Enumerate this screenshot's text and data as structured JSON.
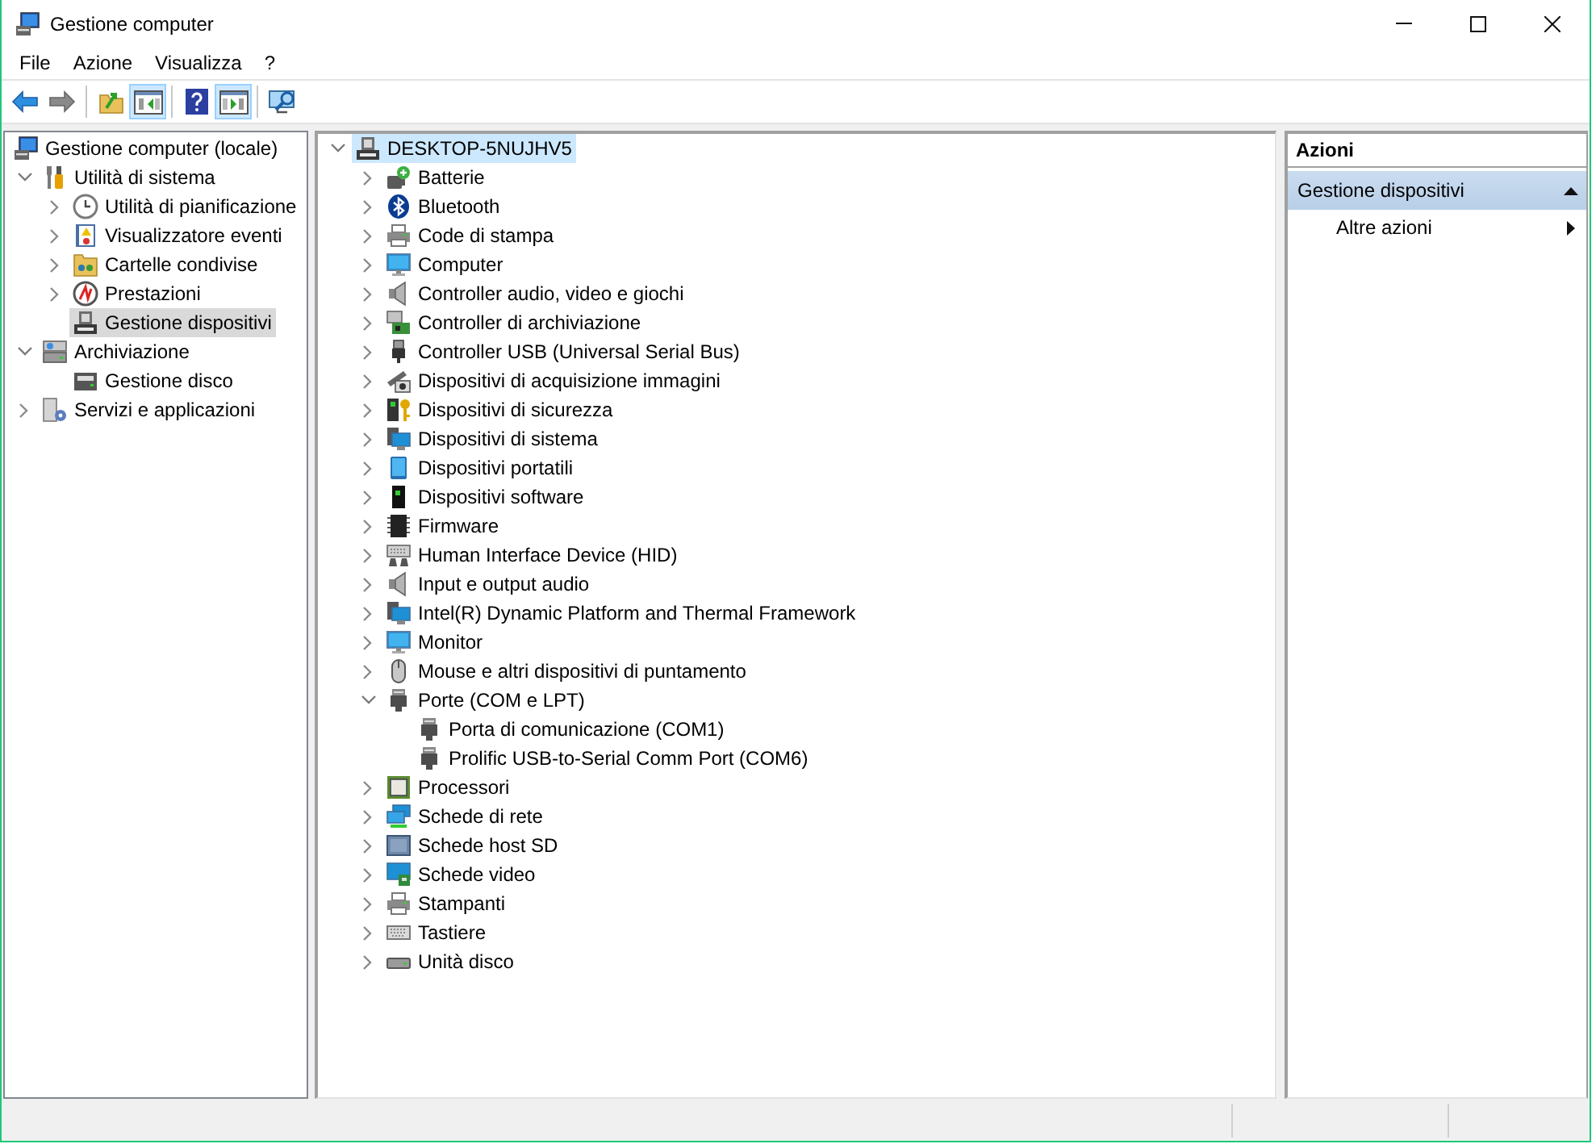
{
  "window": {
    "title": "Gestione computer"
  },
  "menu": [
    "File",
    "Azione",
    "Visualizza",
    "?"
  ],
  "toolbar": {
    "groups": [
      {
        "buttons": [
          {
            "kind": "back",
            "pressed": false,
            "disabled": false
          },
          {
            "kind": "forward",
            "pressed": false,
            "disabled": true
          }
        ]
      },
      {
        "buttons": [
          {
            "kind": "up",
            "pressed": false,
            "disabled": false
          },
          {
            "kind": "tree",
            "pressed": true,
            "disabled": false
          }
        ]
      },
      {
        "buttons": [
          {
            "kind": "help",
            "pressed": false,
            "disabled": false
          },
          {
            "kind": "actionpane",
            "pressed": true,
            "disabled": false
          }
        ]
      },
      {
        "buttons": [
          {
            "kind": "monitor",
            "pressed": false,
            "disabled": false
          }
        ]
      }
    ]
  },
  "console_tree": {
    "root": {
      "label": "Gestione computer (locale)",
      "kind": "management",
      "selected": false,
      "children": [
        {
          "label": "Utilità di sistema",
          "kind": "tools",
          "selected": false,
          "expanded": true,
          "children": [
            {
              "label": "Utilità di pianificazione",
              "kind": "clock",
              "selected": false,
              "expanded": false
            },
            {
              "label": "Visualizzatore eventi",
              "kind": "eventlog",
              "selected": false,
              "expanded": false
            },
            {
              "label": "Cartelle condivise",
              "kind": "shared",
              "selected": false,
              "expanded": false
            },
            {
              "label": "Prestazioni",
              "kind": "performance",
              "selected": false,
              "expanded": false
            },
            {
              "label": "Gestione dispositivi",
              "kind": "device",
              "selected": true
            }
          ]
        },
        {
          "label": "Archiviazione",
          "kind": "storage",
          "selected": false,
          "expanded": true,
          "children": [
            {
              "label": "Gestione disco",
              "kind": "diskmgmt",
              "selected": false
            }
          ]
        },
        {
          "label": "Servizi e applicazioni",
          "kind": "services",
          "selected": false,
          "expanded": false
        }
      ]
    }
  },
  "device_tree": {
    "root": {
      "label": "DESKTOP-5NUJHV5",
      "kind": "device",
      "selected": true,
      "expanded": true,
      "children": [
        {
          "label": "Batterie",
          "kind": "battery",
          "selected": false,
          "expanded": false
        },
        {
          "label": "Bluetooth",
          "kind": "bluetooth",
          "selected": false,
          "expanded": false
        },
        {
          "label": "Code di stampa",
          "kind": "printer",
          "selected": false,
          "expanded": false
        },
        {
          "label": "Computer",
          "kind": "monitor",
          "selected": false,
          "expanded": false
        },
        {
          "label": "Controller audio, video e giochi",
          "kind": "speaker",
          "selected": false,
          "expanded": false
        },
        {
          "label": "Controller di archiviazione",
          "kind": "storagectl",
          "selected": false,
          "expanded": false
        },
        {
          "label": "Controller USB (Universal Serial Bus)",
          "kind": "usb",
          "selected": false,
          "expanded": false
        },
        {
          "label": "Dispositivi di acquisizione immagini",
          "kind": "camera",
          "selected": false,
          "expanded": false
        },
        {
          "label": "Dispositivi di sicurezza",
          "kind": "security",
          "selected": false,
          "expanded": false
        },
        {
          "label": "Dispositivi di sistema",
          "kind": "system",
          "selected": false,
          "expanded": false
        },
        {
          "label": "Dispositivi portatili",
          "kind": "portable",
          "selected": false,
          "expanded": false
        },
        {
          "label": "Dispositivi software",
          "kind": "software",
          "selected": false,
          "expanded": false
        },
        {
          "label": "Firmware",
          "kind": "firmware",
          "selected": false,
          "expanded": false
        },
        {
          "label": "Human Interface Device (HID)",
          "kind": "hid",
          "selected": false,
          "expanded": false
        },
        {
          "label": "Input e output audio",
          "kind": "speaker",
          "selected": false,
          "expanded": false
        },
        {
          "label": "Intel(R) Dynamic Platform and Thermal Framework",
          "kind": "system",
          "selected": false,
          "expanded": false
        },
        {
          "label": "Monitor",
          "kind": "monitor",
          "selected": false,
          "expanded": false
        },
        {
          "label": "Mouse e altri dispositivi di puntamento",
          "kind": "mouse",
          "selected": false,
          "expanded": false
        },
        {
          "label": "Porte (COM e LPT)",
          "kind": "port",
          "selected": false,
          "expanded": true,
          "children": [
            {
              "label": "Porta di comunicazione (COM1)",
              "kind": "port",
              "selected": false
            },
            {
              "label": "Prolific USB-to-Serial Comm Port (COM6)",
              "kind": "port",
              "selected": false
            }
          ]
        },
        {
          "label": "Processori",
          "kind": "cpu",
          "selected": false,
          "expanded": false
        },
        {
          "label": "Schede di rete",
          "kind": "network",
          "selected": false,
          "expanded": false
        },
        {
          "label": "Schede host SD",
          "kind": "sd",
          "selected": false,
          "expanded": false
        },
        {
          "label": "Schede video",
          "kind": "video",
          "selected": false,
          "expanded": false
        },
        {
          "label": "Stampanti",
          "kind": "printer",
          "selected": false,
          "expanded": false
        },
        {
          "label": "Tastiere",
          "kind": "keyboard",
          "selected": false,
          "expanded": false
        },
        {
          "label": "Unità disco",
          "kind": "disk",
          "selected": false,
          "expanded": false
        }
      ]
    }
  },
  "actions_pane": {
    "title": "Azioni",
    "sections": [
      {
        "label": "Gestione dispositivi",
        "expanded": true,
        "items": [
          {
            "label": "Altre azioni",
            "submenu": true
          }
        ]
      }
    ]
  }
}
